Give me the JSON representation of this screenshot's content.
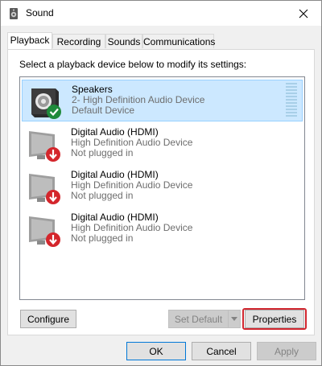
{
  "window": {
    "title": "Sound"
  },
  "tabs": [
    {
      "label": "Playback"
    },
    {
      "label": "Recording"
    },
    {
      "label": "Sounds"
    },
    {
      "label": "Communications"
    }
  ],
  "panel": {
    "instruction": "Select a playback device below to modify its settings:"
  },
  "devices": [
    {
      "name": "Speakers",
      "description": "2- High Definition Audio Device",
      "status": "Default Device",
      "icon": "speaker-icon",
      "badge": "default-check-icon",
      "selected": true
    },
    {
      "name": "Digital Audio (HDMI)",
      "description": "High Definition Audio Device",
      "status": "Not plugged in",
      "icon": "monitor-icon",
      "badge": "not-plugged-arrow-icon",
      "selected": false
    },
    {
      "name": "Digital Audio (HDMI)",
      "description": "High Definition Audio Device",
      "status": "Not plugged in",
      "icon": "monitor-icon",
      "badge": "not-plugged-arrow-icon",
      "selected": false
    },
    {
      "name": "Digital Audio (HDMI)",
      "description": "High Definition Audio Device",
      "status": "Not plugged in",
      "icon": "monitor-icon",
      "badge": "not-plugged-arrow-icon",
      "selected": false
    }
  ],
  "buttons": {
    "configure": "Configure",
    "set_default": "Set Default",
    "properties": "Properties",
    "ok": "OK",
    "cancel": "Cancel",
    "apply": "Apply"
  },
  "colors": {
    "selection": "#cce8ff",
    "highlight_ring": "#d1262f",
    "status_green": "#1f8a3b",
    "status_red": "#d4262c"
  }
}
